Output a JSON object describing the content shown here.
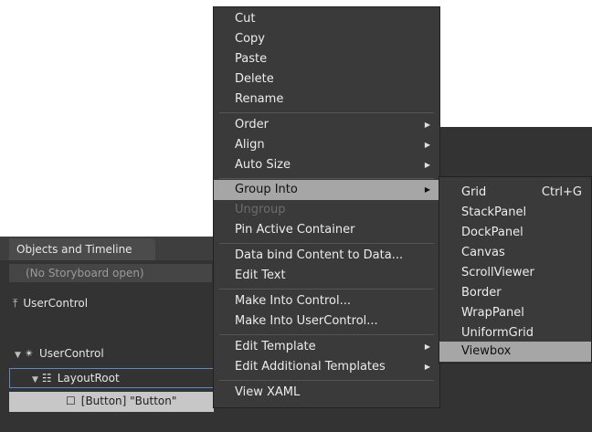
{
  "panel": {
    "tab_label": "Objects and Timeline",
    "storyboard_text": "(No Storyboard open)",
    "tree": {
      "usercontrol_top": "UserControl",
      "usercontrol": "UserControl",
      "layoutroot": "LayoutRoot",
      "button": "[Button] \"Button\""
    }
  },
  "context_menu": {
    "items": [
      {
        "label": "Cut"
      },
      {
        "label": "Copy"
      },
      {
        "label": "Paste"
      },
      {
        "label": "Delete"
      },
      {
        "label": "Rename"
      },
      {
        "label": "Order",
        "submenu": true
      },
      {
        "label": "Align",
        "submenu": true
      },
      {
        "label": "Auto Size",
        "submenu": true
      },
      {
        "label": "Group Into",
        "submenu": true,
        "highlighted": true
      },
      {
        "label": "Ungroup",
        "disabled": true
      },
      {
        "label": "Pin Active Container"
      },
      {
        "label": "Data bind Content to Data..."
      },
      {
        "label": "Edit Text"
      },
      {
        "label": "Make Into Control..."
      },
      {
        "label": "Make Into UserControl..."
      },
      {
        "label": "Edit Template",
        "submenu": true
      },
      {
        "label": "Edit Additional Templates",
        "submenu": true
      },
      {
        "label": "View XAML"
      }
    ]
  },
  "group_into_submenu": {
    "items": [
      {
        "label": "Grid",
        "shortcut": "Ctrl+G"
      },
      {
        "label": "StackPanel"
      },
      {
        "label": "DockPanel"
      },
      {
        "label": "Canvas"
      },
      {
        "label": "ScrollViewer"
      },
      {
        "label": "Border"
      },
      {
        "label": "WrapPanel"
      },
      {
        "label": "UniformGrid"
      },
      {
        "label": "Viewbox",
        "highlighted": true
      }
    ]
  },
  "icons": {
    "submenu_arrow": "triangle-right-icon",
    "expand": "triangle-down-icon",
    "usercontrol": "usercontrol-icon",
    "layoutroot": "grid-icon",
    "button": "button-icon"
  }
}
